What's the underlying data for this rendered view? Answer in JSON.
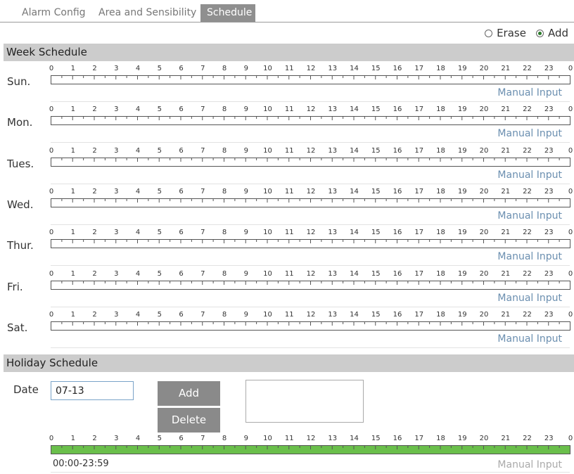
{
  "tabs": [
    "Alarm Config",
    "Area and Sensibility",
    "Schedule"
  ],
  "active_tab": 2,
  "mode": {
    "erase_label": "Erase",
    "add_label": "Add",
    "selected": "Add"
  },
  "week_section_title": "Week Schedule",
  "days": [
    "Sun.",
    "Mon.",
    "Tues.",
    "Wed.",
    "Thur.",
    "Fri.",
    "Sat."
  ],
  "hour_labels": [
    "0",
    "1",
    "2",
    "3",
    "4",
    "5",
    "6",
    "7",
    "8",
    "9",
    "10",
    "11",
    "12",
    "13",
    "14",
    "15",
    "16",
    "17",
    "18",
    "19",
    "20",
    "21",
    "22",
    "23",
    "0"
  ],
  "manual_input_label": "Manual Input",
  "holiday_section_title": "Holiday Schedule",
  "holiday": {
    "date_label": "Date",
    "date_value": "07-13",
    "add_button": "Add",
    "delete_button": "Delete",
    "time_range": "00:00-23:59",
    "manual_input_label": "Manual Input",
    "fill_color": "#6abf4b",
    "fill_fraction": 1.0
  }
}
